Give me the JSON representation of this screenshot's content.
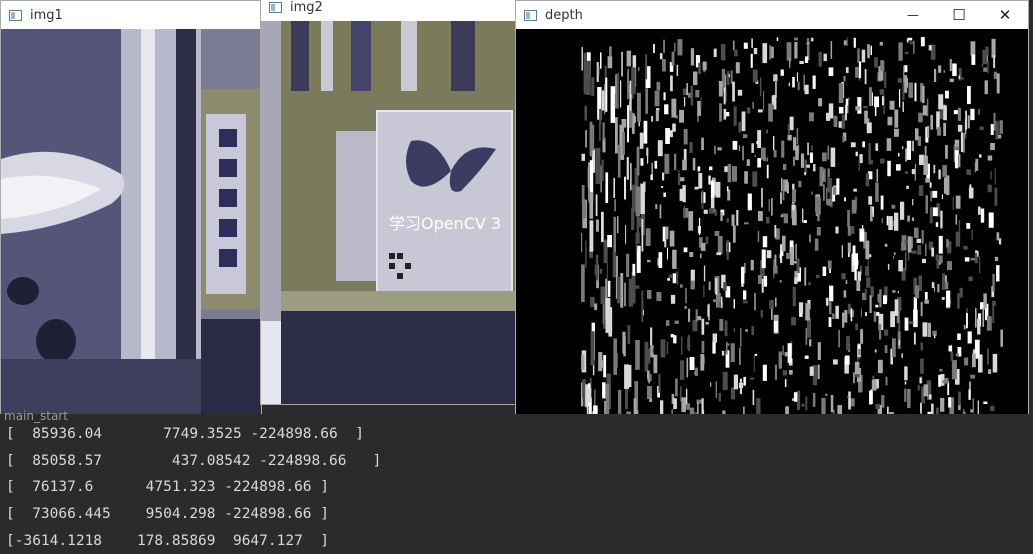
{
  "windows": {
    "img1": {
      "title": "img1"
    },
    "img2": {
      "title": "img2"
    },
    "depth": {
      "title": "depth"
    }
  },
  "book": {
    "title": "学习OpenCV 3"
  },
  "controls": {
    "minimize": "—",
    "maximize": "☐",
    "close": "✕"
  },
  "console": {
    "header": "main_start",
    "lines": [
      "[  85936.04       7749.3525 -224898.66  ]",
      "[  85058.57        437.08542 -224898.66   ]",
      "[  76137.6      4751.323 -224898.66 ]",
      "[  73066.445    9504.298 -224898.66 ]",
      "[-3614.1218    178.85869  9647.127  ]"
    ]
  }
}
